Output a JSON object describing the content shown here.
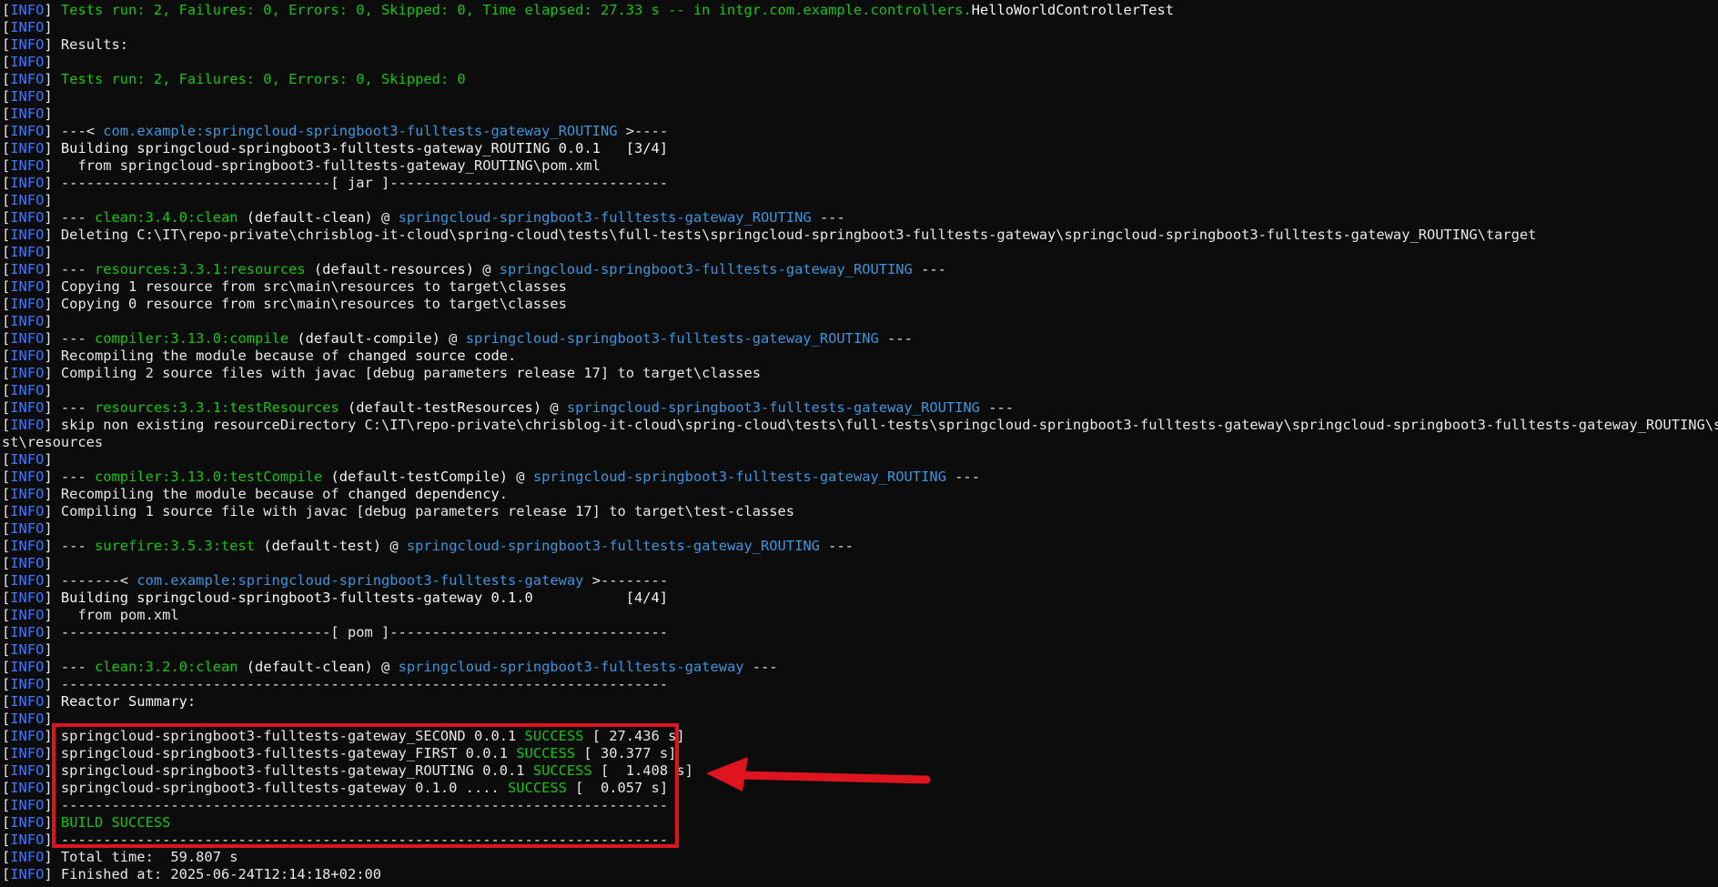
{
  "prefix": {
    "open": "[",
    "level": "INFO",
    "close": "]"
  },
  "lines": [
    {
      "segs": [
        {
          "t": " ",
          "c": "c-default"
        },
        {
          "t": "Tests run: 2, Failures: 0, Errors: 0, Skipped: 0, Time elapsed: 27.33 s -- in intgr.com.example.controllers.",
          "c": "c-green"
        },
        {
          "t": "HelloWorldControllerTest",
          "c": "c-bright"
        }
      ]
    },
    {
      "segs": []
    },
    {
      "segs": [
        {
          "t": " Results:",
          "c": "c-default"
        }
      ]
    },
    {
      "segs": []
    },
    {
      "segs": [
        {
          "t": " ",
          "c": "c-default"
        },
        {
          "t": "Tests run: 2, Failures: 0, Errors: 0, Skipped: 0",
          "c": "c-green"
        }
      ]
    },
    {
      "segs": []
    },
    {
      "segs": []
    },
    {
      "segs": [
        {
          "t": " ---< ",
          "c": "c-default"
        },
        {
          "t": "com.example:springcloud-springboot3-fulltests-gateway_ROUTING",
          "c": "c-cyan"
        },
        {
          "t": " >----",
          "c": "c-default"
        }
      ]
    },
    {
      "segs": [
        {
          "t": " Building springcloud-springboot3-fulltests-gateway_ROUTING 0.0.1   [3/4]",
          "c": "c-bright"
        }
      ]
    },
    {
      "segs": [
        {
          "t": "   from springcloud-springboot3-fulltests-gateway_ROUTING\\pom.xml",
          "c": "c-default"
        }
      ]
    },
    {
      "segs": [
        {
          "t": " --------------------------------[ jar ]---------------------------------",
          "c": "c-default"
        }
      ]
    },
    {
      "segs": []
    },
    {
      "segs": [
        {
          "t": " --- ",
          "c": "c-default"
        },
        {
          "t": "clean:3.4.0:clean",
          "c": "c-green"
        },
        {
          "t": " (default-clean)",
          "c": "c-bright"
        },
        {
          "t": " @ ",
          "c": "c-default"
        },
        {
          "t": "springcloud-springboot3-fulltests-gateway_ROUTING",
          "c": "c-cyan"
        },
        {
          "t": " ---",
          "c": "c-default"
        }
      ]
    },
    {
      "segs": [
        {
          "t": " Deleting C:\\IT\\repo-private\\chrisblog-it-cloud\\spring-cloud\\tests\\full-tests\\springcloud-springboot3-fulltests-gateway\\springcloud-springboot3-fulltests-gateway_ROUTING\\target",
          "c": "c-default"
        }
      ]
    },
    {
      "segs": []
    },
    {
      "segs": [
        {
          "t": " --- ",
          "c": "c-default"
        },
        {
          "t": "resources:3.3.1:resources",
          "c": "c-green"
        },
        {
          "t": " (default-resources)",
          "c": "c-bright"
        },
        {
          "t": " @ ",
          "c": "c-default"
        },
        {
          "t": "springcloud-springboot3-fulltests-gateway_ROUTING",
          "c": "c-cyan"
        },
        {
          "t": " ---",
          "c": "c-default"
        }
      ]
    },
    {
      "segs": [
        {
          "t": " Copying 1 resource from src\\main\\resources to target\\classes",
          "c": "c-default"
        }
      ]
    },
    {
      "segs": [
        {
          "t": " Copying 0 resource from src\\main\\resources to target\\classes",
          "c": "c-default"
        }
      ]
    },
    {
      "segs": []
    },
    {
      "segs": [
        {
          "t": " --- ",
          "c": "c-default"
        },
        {
          "t": "compiler:3.13.0:compile",
          "c": "c-green"
        },
        {
          "t": " (default-compile)",
          "c": "c-bright"
        },
        {
          "t": " @ ",
          "c": "c-default"
        },
        {
          "t": "springcloud-springboot3-fulltests-gateway_ROUTING",
          "c": "c-cyan"
        },
        {
          "t": " ---",
          "c": "c-default"
        }
      ]
    },
    {
      "segs": [
        {
          "t": " Recompiling the module because of ",
          "c": "c-default"
        },
        {
          "t": "changed source code",
          "c": "c-bright"
        },
        {
          "t": ".",
          "c": "c-default"
        }
      ]
    },
    {
      "segs": [
        {
          "t": " Compiling 2 source files with javac [debug parameters release 17] to target\\classes",
          "c": "c-default"
        }
      ]
    },
    {
      "segs": []
    },
    {
      "segs": [
        {
          "t": " --- ",
          "c": "c-default"
        },
        {
          "t": "resources:3.3.1:testResources",
          "c": "c-green"
        },
        {
          "t": " (default-testResources)",
          "c": "c-bright"
        },
        {
          "t": " @ ",
          "c": "c-default"
        },
        {
          "t": "springcloud-springboot3-fulltests-gateway_ROUTING",
          "c": "c-cyan"
        },
        {
          "t": " ---",
          "c": "c-default"
        }
      ]
    },
    {
      "segs": [
        {
          "t": " skip non existing resourceDirectory C:\\IT\\repo-private\\chrisblog-it-cloud\\spring-cloud\\tests\\full-tests\\springcloud-springboot3-fulltests-gateway\\springcloud-springboot3-fulltests-gateway_ROUTING\\src\\te",
          "c": "c-default"
        }
      ]
    },
    {
      "segs": [
        {
          "t": "st\\resources",
          "c": "c-default"
        }
      ],
      "noprefix": true
    },
    {
      "segs": []
    },
    {
      "segs": [
        {
          "t": " --- ",
          "c": "c-default"
        },
        {
          "t": "compiler:3.13.0:testCompile",
          "c": "c-green"
        },
        {
          "t": " (default-testCompile)",
          "c": "c-bright"
        },
        {
          "t": " @ ",
          "c": "c-default"
        },
        {
          "t": "springcloud-springboot3-fulltests-gateway_ROUTING",
          "c": "c-cyan"
        },
        {
          "t": " ---",
          "c": "c-default"
        }
      ]
    },
    {
      "segs": [
        {
          "t": " Recompiling the module because of ",
          "c": "c-default"
        },
        {
          "t": "changed dependency",
          "c": "c-bright"
        },
        {
          "t": ".",
          "c": "c-default"
        }
      ]
    },
    {
      "segs": [
        {
          "t": " Compiling 1 source file with javac [debug parameters release 17] to target\\test-classes",
          "c": "c-default"
        }
      ]
    },
    {
      "segs": []
    },
    {
      "segs": [
        {
          "t": " --- ",
          "c": "c-default"
        },
        {
          "t": "surefire:3.5.3:test",
          "c": "c-green"
        },
        {
          "t": " (default-test)",
          "c": "c-bright"
        },
        {
          "t": " @ ",
          "c": "c-default"
        },
        {
          "t": "springcloud-springboot3-fulltests-gateway_ROUTING",
          "c": "c-cyan"
        },
        {
          "t": " ---",
          "c": "c-default"
        }
      ]
    },
    {
      "segs": []
    },
    {
      "segs": [
        {
          "t": " -------< ",
          "c": "c-default"
        },
        {
          "t": "com.example:springcloud-springboot3-fulltests-gateway",
          "c": "c-cyan"
        },
        {
          "t": " >--------",
          "c": "c-default"
        }
      ]
    },
    {
      "segs": [
        {
          "t": " Building springcloud-springboot3-fulltests-gateway 0.1.0           [4/4]",
          "c": "c-bright"
        }
      ]
    },
    {
      "segs": [
        {
          "t": "   from pom.xml",
          "c": "c-default"
        }
      ]
    },
    {
      "segs": [
        {
          "t": " --------------------------------[ pom ]---------------------------------",
          "c": "c-default"
        }
      ]
    },
    {
      "segs": []
    },
    {
      "segs": [
        {
          "t": " --- ",
          "c": "c-default"
        },
        {
          "t": "clean:3.2.0:clean",
          "c": "c-green"
        },
        {
          "t": " (default-clean)",
          "c": "c-bright"
        },
        {
          "t": " @ ",
          "c": "c-default"
        },
        {
          "t": "springcloud-springboot3-fulltests-gateway",
          "c": "c-cyan"
        },
        {
          "t": " ---",
          "c": "c-default"
        }
      ]
    },
    {
      "segs": [
        {
          "t": " ------------------------------------------------------------------------",
          "c": "c-default"
        }
      ]
    },
    {
      "segs": [
        {
          "t": " Reactor Summary:",
          "c": "c-bright"
        }
      ]
    },
    {
      "segs": []
    },
    {
      "segs": [
        {
          "t": " springcloud-springboot3-fulltests-gateway_SECOND 0.0.1 ",
          "c": "c-default"
        },
        {
          "t": "SUCCESS",
          "c": "c-green"
        },
        {
          "t": " [ 27.436 s]",
          "c": "c-default"
        }
      ]
    },
    {
      "segs": [
        {
          "t": " springcloud-springboot3-fulltests-gateway_FIRST 0.0.1 ",
          "c": "c-default"
        },
        {
          "t": "SUCCESS",
          "c": "c-green"
        },
        {
          "t": " [ 30.377 s]",
          "c": "c-default"
        }
      ]
    },
    {
      "segs": [
        {
          "t": " springcloud-springboot3-fulltests-gateway_ROUTING 0.0.1 ",
          "c": "c-default"
        },
        {
          "t": "SUCCESS",
          "c": "c-green"
        },
        {
          "t": " [  1.408 s]",
          "c": "c-default"
        }
      ]
    },
    {
      "segs": [
        {
          "t": " springcloud-springboot3-fulltests-gateway 0.1.0 .... ",
          "c": "c-default"
        },
        {
          "t": "SUCCESS",
          "c": "c-green"
        },
        {
          "t": " [  0.057 s]",
          "c": "c-default"
        }
      ]
    },
    {
      "segs": [
        {
          "t": " ------------------------------------------------------------------------",
          "c": "c-default"
        }
      ]
    },
    {
      "segs": [
        {
          "t": " ",
          "c": "c-default"
        },
        {
          "t": "BUILD SUCCESS",
          "c": "c-green"
        }
      ]
    },
    {
      "segs": [
        {
          "t": " ------------------------------------------------------------------------",
          "c": "c-default"
        }
      ]
    },
    {
      "segs": [
        {
          "t": " Total time:  59.807 s",
          "c": "c-default"
        }
      ]
    },
    {
      "segs": [
        {
          "t": " Finished at: 2025-06-24T12:14:18+02:00",
          "c": "c-default"
        }
      ]
    }
  ],
  "colors": {
    "background": "#0c0c0c",
    "info_tag": "#3b78ff",
    "success_green": "#16c60c",
    "artifact_cyan": "#3a96dd",
    "annotation_red": "#e0141e"
  },
  "annotations": {
    "highlight_box": "red-rectangle",
    "arrow": "red-arrow-pointing-left"
  }
}
